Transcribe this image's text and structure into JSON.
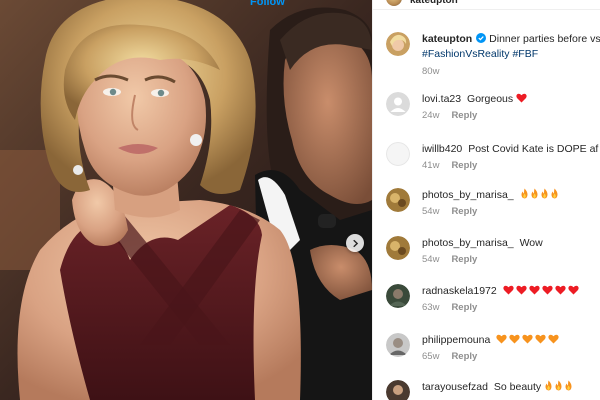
{
  "post_header": {
    "username": "kateupton",
    "follow_label": "Follow"
  },
  "caption": {
    "username": "kateupton",
    "text": "Dinner parties before vs af",
    "hashtags": "#FashionVsReality #FBF",
    "time": "80w"
  },
  "comments": [
    {
      "username": "lovi.ta23",
      "text": "Gorgeous",
      "emoji": "red-heart",
      "emoji_count": 1,
      "time": "24w",
      "reply_label": "Reply"
    },
    {
      "username": "iwillb420",
      "text": "Post Covid Kate is DOPE af",
      "emoji": "flexed-arm",
      "emoji_count": 1,
      "time": "41w",
      "reply_label": "Reply"
    },
    {
      "username": "photos_by_marisa_",
      "text": "",
      "emoji": "fire",
      "emoji_count": 4,
      "time": "54w",
      "reply_label": "Reply"
    },
    {
      "username": "photos_by_marisa_",
      "text": "Wow",
      "emoji": "",
      "emoji_count": 0,
      "time": "54w",
      "reply_label": "Reply"
    },
    {
      "username": "radnaskela1972",
      "text": "",
      "emoji": "red-heart",
      "emoji_count": 6,
      "time": "63w",
      "reply_label": "Reply"
    },
    {
      "username": "philippemouna",
      "text": "",
      "emoji": "orange-heart",
      "emoji_count": 5,
      "time": "65w",
      "reply_label": "Reply"
    },
    {
      "username": "tarayousefzad",
      "text": "So beauty",
      "emoji": "fire",
      "emoji_count": 3,
      "time": "",
      "reply_label": ""
    }
  ],
  "colors": {
    "link": "#00376b",
    "follow": "#0095f6",
    "muted": "#8e8e8e",
    "red_heart": "#ed1c24",
    "orange_heart": "#f7931e",
    "verified": "#0095f6"
  }
}
